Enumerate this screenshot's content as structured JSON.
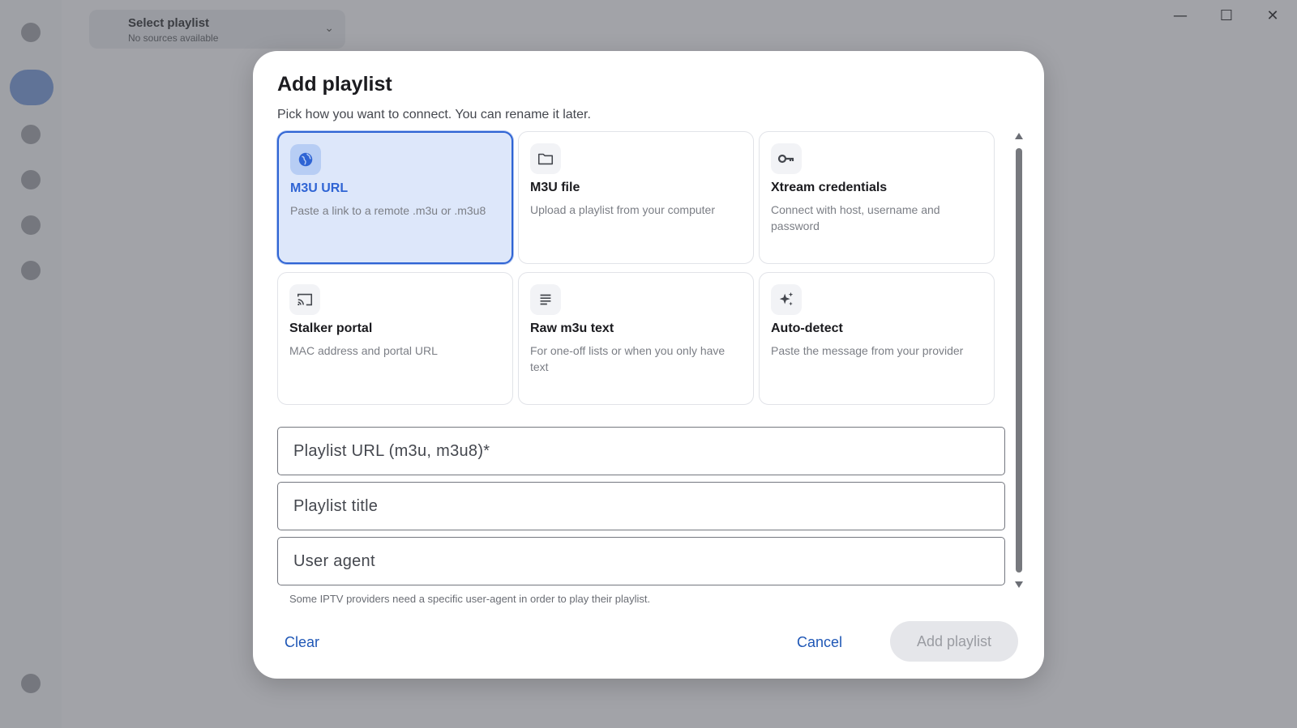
{
  "window": {
    "minimize_glyph": "—",
    "maximize_glyph": "☐",
    "close_glyph": "✕"
  },
  "background": {
    "playlist_selector_title": "Select playlist",
    "playlist_selector_subtitle": "No sources available",
    "chevron_glyph": "⌄"
  },
  "dialog": {
    "title": "Add playlist",
    "subtitle": "Pick how you want to connect. You can rename it later.",
    "options": [
      {
        "title": "M3U URL",
        "description": "Paste a link to a remote .m3u or .m3u8",
        "icon": "globe-icon",
        "selected": true
      },
      {
        "title": "M3U file",
        "description": "Upload a playlist from your computer",
        "icon": "folder-icon",
        "selected": false
      },
      {
        "title": "Xtream credentials",
        "description": "Connect with host, username and password",
        "icon": "key-icon",
        "selected": false
      },
      {
        "title": "Stalker portal",
        "description": "MAC address and portal URL",
        "icon": "cast-icon",
        "selected": false
      },
      {
        "title": "Raw m3u text",
        "description": "For one-off lists or when you only have text",
        "icon": "text-lines-icon",
        "selected": false
      },
      {
        "title": "Auto-detect",
        "description": "Paste the message from your provider",
        "icon": "sparkle-icon",
        "selected": false
      }
    ],
    "fields": {
      "url_placeholder": "Playlist URL (m3u, m3u8)*",
      "url_value": "",
      "title_placeholder": "Playlist title",
      "title_value": "",
      "user_agent_placeholder": "User agent",
      "user_agent_value": ""
    },
    "user_agent_hint": "Some IPTV providers need a specific user-agent in order to play their playlist.",
    "actions": {
      "clear": "Clear",
      "cancel": "Cancel",
      "add": "Add playlist"
    }
  },
  "colors": {
    "accent": "#2f64d4",
    "selected_card_bg": "#dde7fa",
    "action_text": "#1f57b6",
    "disabled_button_bg": "#e5e6ea"
  }
}
